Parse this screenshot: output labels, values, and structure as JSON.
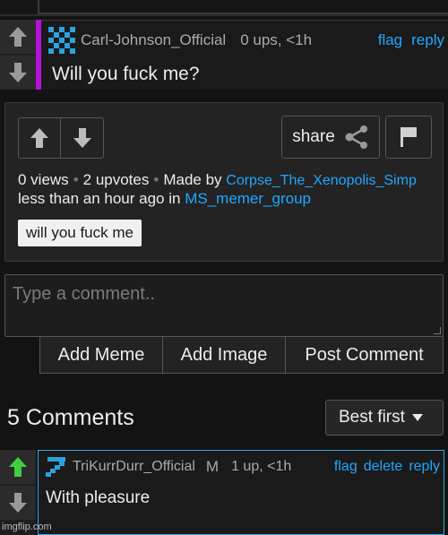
{
  "parent_comment": {
    "username": "Carl-Johnson_Official",
    "stats": "0 ups, <1h",
    "actions": [
      "flag",
      "reply"
    ],
    "text": "Will you fuck me?",
    "highlight_color": "#b512d8"
  },
  "meme_panel": {
    "share_label": "share",
    "views": "0 views",
    "upvotes": "2 upvotes",
    "made_by_prefix": "Made by",
    "creator": "Corpse_The_Xenopolis_Simp",
    "time_prefix": "less than an hour ago in",
    "group": "MS_memer_group",
    "tag": "will you fuck me"
  },
  "comment_form": {
    "placeholder": "Type a comment..",
    "buttons": [
      "Add Meme",
      "Add Image",
      "Post Comment"
    ]
  },
  "comments_header": {
    "count_label": "5 Comments",
    "sort_value": "Best first"
  },
  "first_comment": {
    "username": "TriKurrDurr_Official",
    "badge": "M",
    "stats": "1 up, <1h",
    "actions": [
      "flag",
      "delete",
      "reply"
    ],
    "text": "With pleasure",
    "upvoted_color": "#3ecf3e"
  },
  "colors": {
    "link": "#1ea8ff",
    "background": "#131313",
    "comment_border": "#3aa6e6"
  },
  "watermark": "imgflip.com"
}
